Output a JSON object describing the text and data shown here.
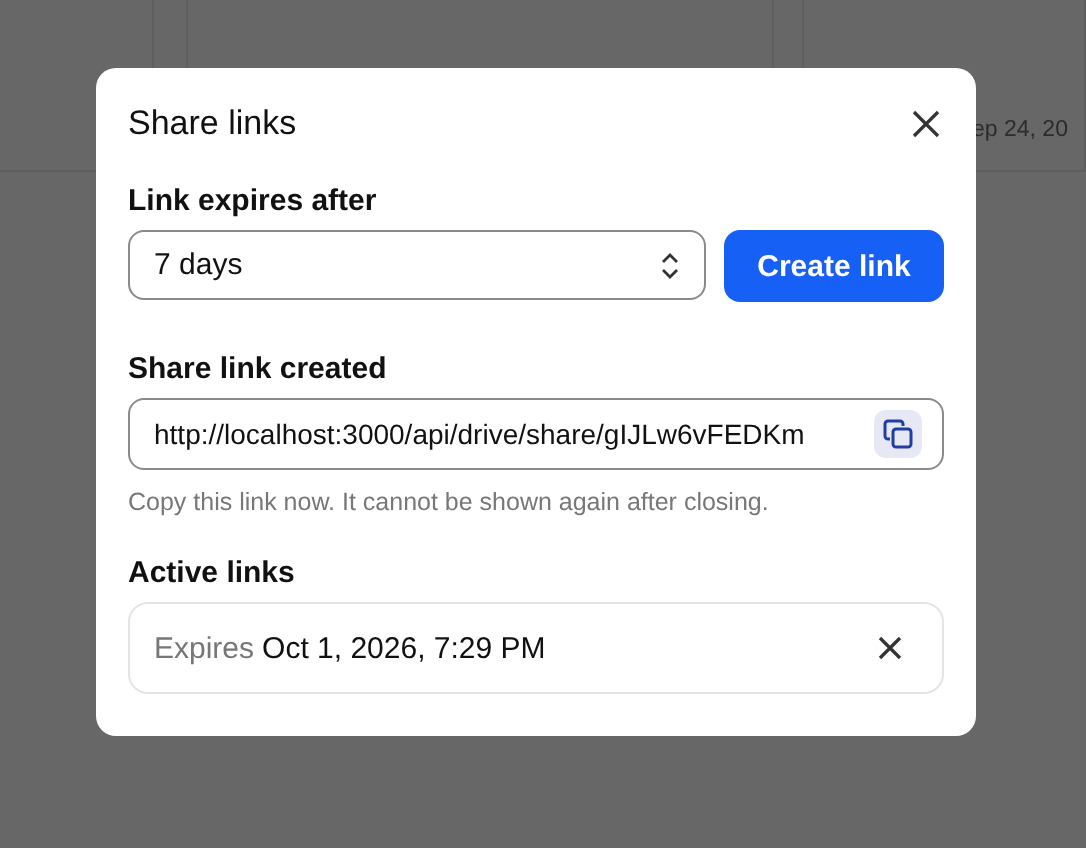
{
  "background": {
    "date_text": "ep 24, 20"
  },
  "dialog": {
    "title": "Share links",
    "expiry": {
      "label": "Link expires after",
      "value": "7 days",
      "create_button": "Create link"
    },
    "created": {
      "label": "Share link created",
      "url": "http://localhost:3000/api/drive/share/gIJLw6vFEDKm",
      "hint": "Copy this link now. It cannot be shown again after closing."
    },
    "active": {
      "label": "Active links",
      "links": [
        {
          "prefix": "Expires",
          "date": "Oct 1, 2026, 7:29 PM"
        }
      ]
    }
  }
}
